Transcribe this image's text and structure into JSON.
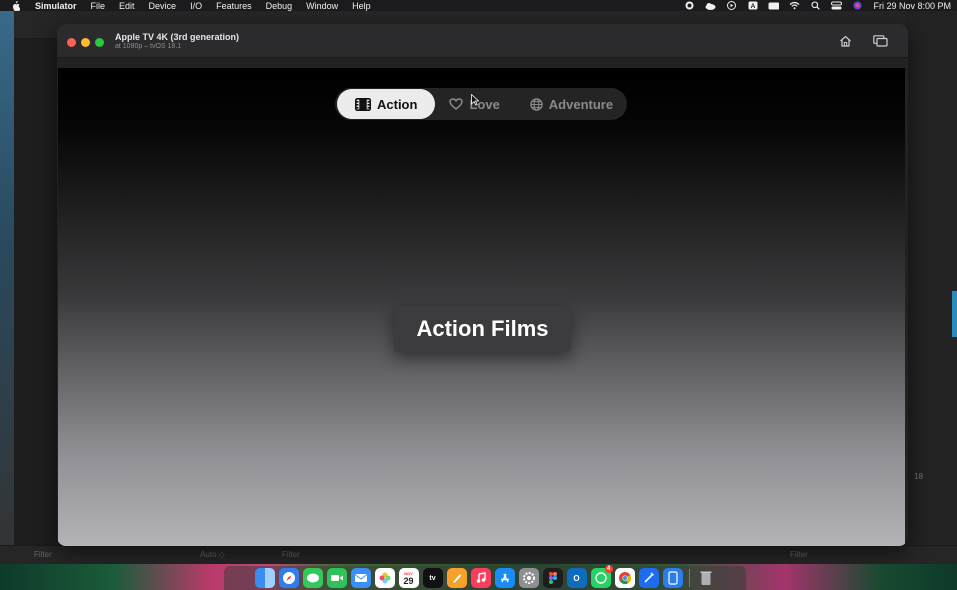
{
  "menubar": {
    "app_name": "Simulator",
    "items": [
      "File",
      "Edit",
      "Device",
      "I/O",
      "Features",
      "Debug",
      "Window",
      "Help"
    ],
    "clock": "Fri 29 Nov  8:00 PM"
  },
  "xcode_background": {
    "bottom_filter_left": "Filter",
    "bottom_auto": "Auto ◇",
    "bottom_filter_mid": "Filter",
    "bottom_filter_right": "Filter",
    "right_badge": "18"
  },
  "simulator": {
    "title": "Apple TV 4K (3rd generation)",
    "subtitle": "at 1080p – tvOS 18.1",
    "home_icon": "home-icon",
    "screenshot_icon": "screenshot-icon"
  },
  "tv_app": {
    "tabs": [
      {
        "label": "Action",
        "icon": "film-icon",
        "selected": true
      },
      {
        "label": "Love",
        "icon": "heart-icon",
        "selected": false
      },
      {
        "label": "Adventure",
        "icon": "globe-icon",
        "selected": false
      }
    ],
    "focus_card_label": "Action Films"
  },
  "dock": {
    "apps": [
      "Finder",
      "Safari",
      "Messages",
      "FaceTime",
      "Mail",
      "Photos",
      "Calendar",
      "TV",
      "Pages",
      "Music",
      "App Store",
      "System Settings",
      "Figma",
      "Outlook",
      "WhatsApp",
      "Chrome",
      "Xcode",
      "Simulator",
      "Trash"
    ],
    "calendar_day": "29",
    "calendar_month": "NOV",
    "whatsapp_badge": "4"
  },
  "colors": {
    "selected_tab_bg": "#ececec",
    "unselected_tab_text": "#8a8a8a",
    "focus_card_bg": "#3c3c3e"
  }
}
